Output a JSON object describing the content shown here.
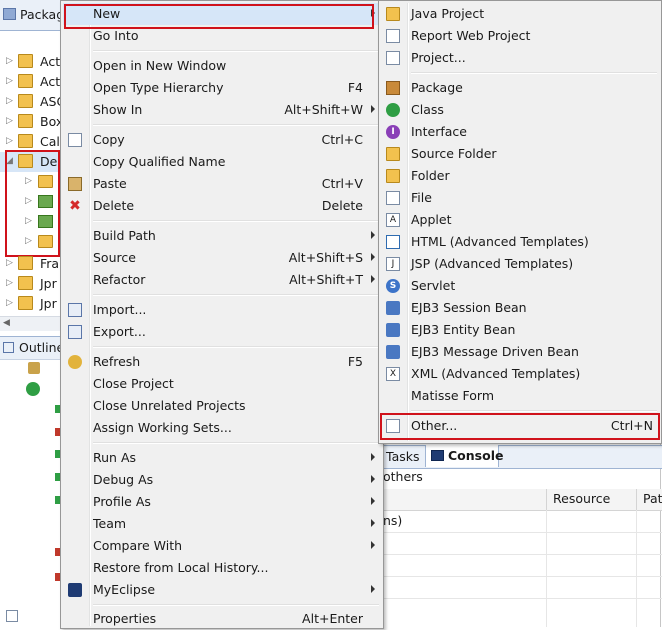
{
  "package_explorer": {
    "tab_title": "Packag",
    "tree": [
      {
        "label": "Act",
        "expanded": false
      },
      {
        "label": "Act",
        "expanded": false
      },
      {
        "label": "ASC",
        "expanded": false
      },
      {
        "label": "Box",
        "expanded": false
      },
      {
        "label": "Cal",
        "expanded": false
      },
      {
        "label": "De",
        "expanded": true
      },
      {
        "label": "Fra",
        "expanded": false
      },
      {
        "label": "Jpr",
        "expanded": false
      },
      {
        "label": "Jpr",
        "expanded": false
      }
    ]
  },
  "outline": {
    "tab_title": "Outline"
  },
  "context_menu": {
    "new": "New",
    "go_into": "Go Into",
    "open_new_window": "Open in New Window",
    "open_type_hierarchy": {
      "label": "Open Type Hierarchy",
      "shortcut": "F4"
    },
    "show_in": {
      "label": "Show In",
      "shortcut": "Alt+Shift+W"
    },
    "copy": {
      "label": "Copy",
      "shortcut": "Ctrl+C"
    },
    "copy_qualified": "Copy Qualified Name",
    "paste": {
      "label": "Paste",
      "shortcut": "Ctrl+V"
    },
    "delete": {
      "label": "Delete",
      "shortcut": "Delete"
    },
    "build_path": "Build Path",
    "source": {
      "label": "Source",
      "shortcut": "Alt+Shift+S"
    },
    "refactor": {
      "label": "Refactor",
      "shortcut": "Alt+Shift+T"
    },
    "import": "Import...",
    "export": "Export...",
    "refresh": {
      "label": "Refresh",
      "shortcut": "F5"
    },
    "close_project": "Close Project",
    "close_unrelated": "Close Unrelated Projects",
    "assign_working_sets": "Assign Working Sets...",
    "run_as": "Run As",
    "debug_as": "Debug As",
    "profile_as": "Profile As",
    "team": "Team",
    "compare_with": "Compare With",
    "restore_history": "Restore from Local History...",
    "myeclipse": "MyEclipse",
    "properties": {
      "label": "Properties",
      "shortcut": "Alt+Enter"
    }
  },
  "new_submenu": {
    "java_project": "Java Project",
    "report_web_project": "Report Web Project",
    "project": "Project...",
    "package": "Package",
    "class": "Class",
    "interface": "Interface",
    "source_folder": "Source Folder",
    "folder": "Folder",
    "file": "File",
    "applet": "Applet",
    "html": "HTML (Advanced Templates)",
    "jsp": "JSP (Advanced Templates)",
    "servlet": "Servlet",
    "ejb3_session": "EJB3 Session Bean",
    "ejb3_entity": "EJB3 Entity Bean",
    "ejb3_message": "EJB3 Message Driven Bean",
    "xml": "XML (Advanced Templates)",
    "matisse": "Matisse Form",
    "other": {
      "label": "Other...",
      "shortcut": "Ctrl+N"
    }
  },
  "bottom_panel": {
    "tasks_tab": "Tasks",
    "console_tab": "Console",
    "summary": "others",
    "columns": [
      "Resource",
      "Pat"
    ],
    "row_text": "ns)"
  },
  "colors": {
    "highlight": "#d0121b",
    "menu_bg": "#f0f0f0",
    "tab_bg": "#eaf0f8"
  }
}
